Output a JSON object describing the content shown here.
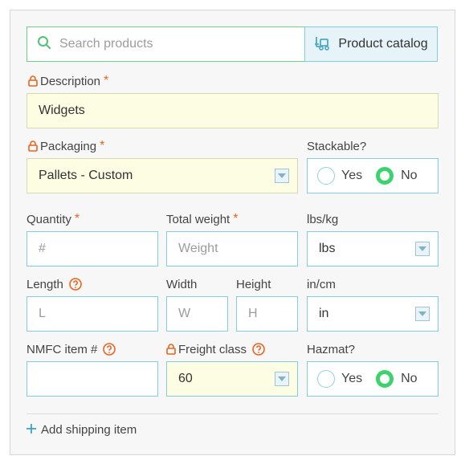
{
  "search": {
    "placeholder": "Search products"
  },
  "catalog_button": {
    "label": "Product catalog"
  },
  "description": {
    "label": "Description",
    "required": "*",
    "value": "Widgets"
  },
  "packaging": {
    "label": "Packaging",
    "required": "*",
    "value": "Pallets - Custom"
  },
  "stackable": {
    "label": "Stackable?",
    "yes": "Yes",
    "no": "No",
    "selected": "No"
  },
  "quantity": {
    "label": "Quantity",
    "required": "*",
    "placeholder": "#"
  },
  "total_weight": {
    "label": "Total weight",
    "required": "*",
    "placeholder": "Weight"
  },
  "weight_unit": {
    "label": "lbs/kg",
    "value": "lbs"
  },
  "length": {
    "label": "Length",
    "placeholder": "L"
  },
  "width": {
    "label": "Width",
    "placeholder": "W"
  },
  "height": {
    "label": "Height",
    "placeholder": "H"
  },
  "dim_unit": {
    "label": "in/cm",
    "value": "in"
  },
  "nmfc": {
    "label": "NMFC item #",
    "value": ""
  },
  "freight_class": {
    "label": "Freight class",
    "value": "60"
  },
  "hazmat": {
    "label": "Hazmat?",
    "yes": "Yes",
    "no": "No",
    "selected": "No"
  },
  "add_item": {
    "label": "Add shipping item"
  },
  "colors": {
    "accent": "#7fcfe0",
    "required": "#e8641f",
    "radio_on": "#3ed26e",
    "field_fill": "#fdfde4"
  }
}
